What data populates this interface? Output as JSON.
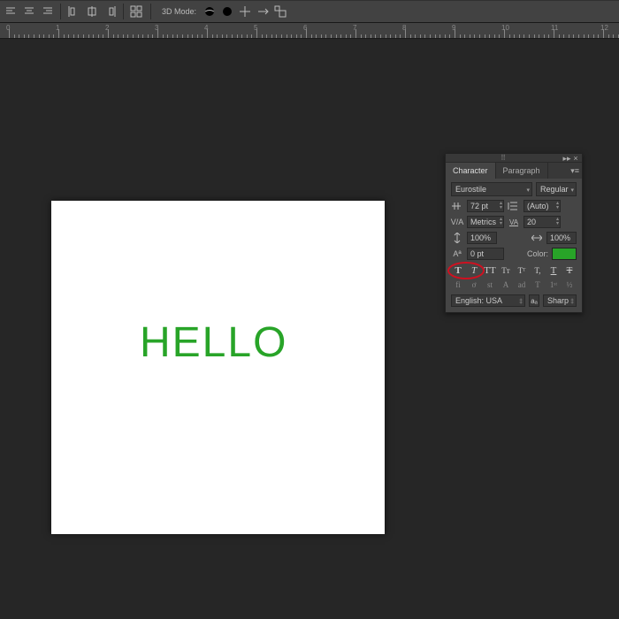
{
  "toolbar": {
    "mode_label": "3D Mode:"
  },
  "ruler": {
    "marks": [
      0,
      1,
      2,
      3,
      4,
      5,
      6,
      7,
      8,
      9,
      10,
      11,
      12
    ]
  },
  "canvas": {
    "text": "HELLO",
    "text_color": "#28a428"
  },
  "panel": {
    "tabs": [
      "Character",
      "Paragraph"
    ],
    "active_tab": 0,
    "font_family": "Eurostile",
    "font_style": "Regular",
    "font_size": "72 pt",
    "leading": "(Auto)",
    "kerning": "Metrics",
    "tracking": "20",
    "scale_v": "100%",
    "scale_h": "100%",
    "baseline": "0 pt",
    "color_label": "Color:",
    "color_value": "#28a428",
    "style_buttons": [
      "T",
      "T",
      "TT",
      "Tᴛ",
      "Tᵀ",
      "T,",
      "T",
      "Ŧ"
    ],
    "ot_buttons": [
      "fi",
      "ơ",
      "st",
      "A",
      "ad",
      "T",
      "1ˢᵗ",
      "½"
    ],
    "language": "English: USA",
    "aa_method": "Sharp"
  }
}
